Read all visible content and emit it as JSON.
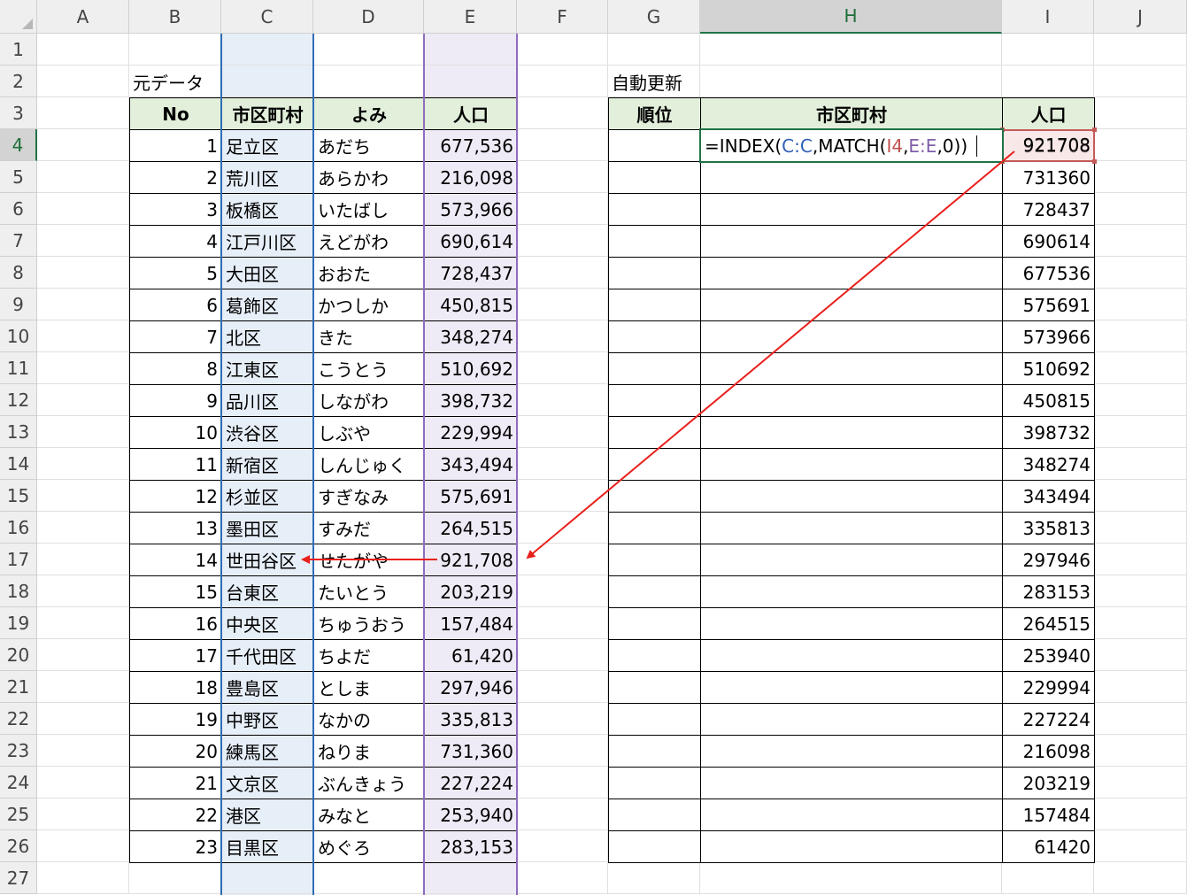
{
  "columns": [
    "A",
    "B",
    "C",
    "D",
    "E",
    "F",
    "G",
    "H",
    "I",
    "J"
  ],
  "rows": [
    "1",
    "2",
    "3",
    "4",
    "5",
    "6",
    "7",
    "8",
    "9",
    "10",
    "11",
    "12",
    "13",
    "14",
    "15",
    "16",
    "17",
    "18",
    "19",
    "20",
    "21",
    "22",
    "23",
    "24",
    "25",
    "26",
    "27"
  ],
  "active_cell": "H4",
  "labels": {
    "source": "元データ",
    "auto": "自動更新"
  },
  "source_table": {
    "headers": [
      "No",
      "市区町村",
      "よみ",
      "人口"
    ],
    "rows": [
      [
        "1",
        "足立区",
        "あだち",
        "677,536"
      ],
      [
        "2",
        "荒川区",
        "あらかわ",
        "216,098"
      ],
      [
        "3",
        "板橋区",
        "いたばし",
        "573,966"
      ],
      [
        "4",
        "江戸川区",
        "えどがわ",
        "690,614"
      ],
      [
        "5",
        "大田区",
        "おおた",
        "728,437"
      ],
      [
        "6",
        "葛飾区",
        "かつしか",
        "450,815"
      ],
      [
        "7",
        "北区",
        "きた",
        "348,274"
      ],
      [
        "8",
        "江東区",
        "こうとう",
        "510,692"
      ],
      [
        "9",
        "品川区",
        "しながわ",
        "398,732"
      ],
      [
        "10",
        "渋谷区",
        "しぶや",
        "229,994"
      ],
      [
        "11",
        "新宿区",
        "しんじゅく",
        "343,494"
      ],
      [
        "12",
        "杉並区",
        "すぎなみ",
        "575,691"
      ],
      [
        "13",
        "墨田区",
        "すみだ",
        "264,515"
      ],
      [
        "14",
        "世田谷区",
        "せたがや",
        "921,708"
      ],
      [
        "15",
        "台東区",
        "たいとう",
        "203,219"
      ],
      [
        "16",
        "中央区",
        "ちゅうおう",
        "157,484"
      ],
      [
        "17",
        "千代田区",
        "ちよだ",
        "61,420"
      ],
      [
        "18",
        "豊島区",
        "としま",
        "297,946"
      ],
      [
        "19",
        "中野区",
        "なかの",
        "335,813"
      ],
      [
        "20",
        "練馬区",
        "ねりま",
        "731,360"
      ],
      [
        "21",
        "文京区",
        "ぶんきょう",
        "227,224"
      ],
      [
        "22",
        "港区",
        "みなと",
        "253,940"
      ],
      [
        "23",
        "目黒区",
        "めぐろ",
        "283,153"
      ]
    ]
  },
  "result_table": {
    "headers": [
      "順位",
      "市区町村",
      "人口"
    ],
    "formula_parts": [
      {
        "text": "=INDEX(",
        "color": "black"
      },
      {
        "text": "C:C",
        "color": "blue"
      },
      {
        "text": ",MATCH(",
        "color": "black"
      },
      {
        "text": "I4",
        "color": "red"
      },
      {
        "text": ",",
        "color": "black"
      },
      {
        "text": "E:E",
        "color": "purple"
      },
      {
        "text": ",0))",
        "color": "black"
      }
    ],
    "population": [
      "921708",
      "731360",
      "728437",
      "690614",
      "677536",
      "575691",
      "573966",
      "510692",
      "450815",
      "398732",
      "348274",
      "343494",
      "335813",
      "297946",
      "283153",
      "264515",
      "253940",
      "229994",
      "227224",
      "216098",
      "203219",
      "157484",
      "61420"
    ]
  },
  "colors": {
    "header_fill": "#e2efda",
    "column_c_highlight": "#e6eef8",
    "column_e_highlight": "#efebf6",
    "arrow": "#e8201c",
    "selection": "#217346"
  }
}
